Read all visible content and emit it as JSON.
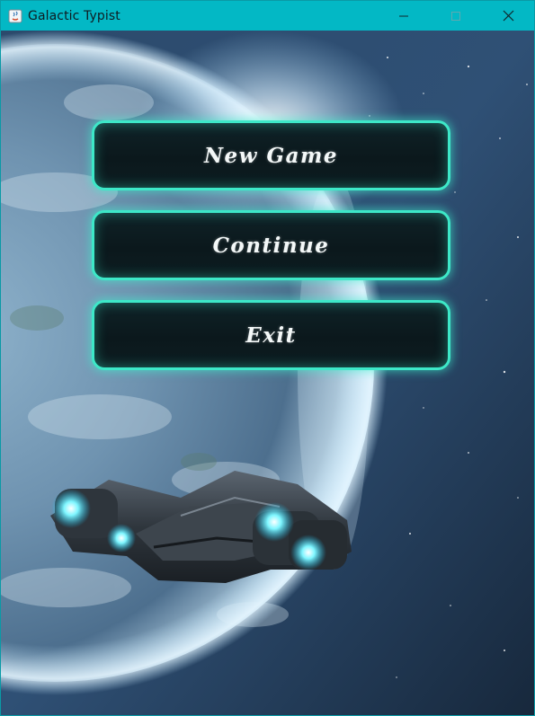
{
  "window": {
    "title": "Galactic Typist",
    "titlebar_color": "#03b8c5"
  },
  "menu": {
    "new_game": "New Game",
    "continue": "Continue",
    "exit": "Exit",
    "border_color": "#3de8c8"
  },
  "icons": {
    "app": "java-app-icon",
    "minimize": "minimize-icon",
    "maximize": "maximize-icon",
    "close": "close-icon"
  }
}
